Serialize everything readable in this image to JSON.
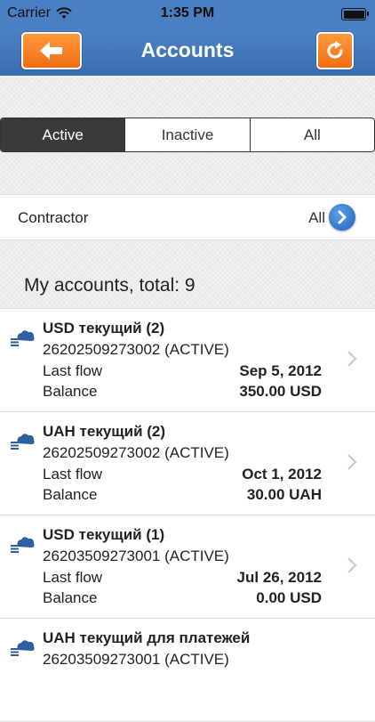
{
  "status": {
    "carrier": "Carrier",
    "time": "1:35 PM"
  },
  "nav": {
    "title": "Accounts"
  },
  "segments": [
    "Active",
    "Inactive",
    "All"
  ],
  "contractor": {
    "label": "Contractor",
    "value": "All"
  },
  "section": {
    "title": "My accounts, total: 9"
  },
  "accounts": [
    {
      "name": "USD текущий (2)",
      "number": "26202509273002 (ACTIVE)",
      "k1": "Last flow",
      "v1": "Sep 5, 2012",
      "k2": "Balance",
      "v2": "350.00 USD"
    },
    {
      "name": "UAH текущий (2)",
      "number": "26202509273002 (ACTIVE)",
      "k1": "Last flow",
      "v1": "Oct 1, 2012",
      "k2": "Balance",
      "v2": "30.00 UAH"
    },
    {
      "name": "USD текущий (1)",
      "number": "26203509273001 (ACTIVE)",
      "k1": "Last flow",
      "v1": "Jul 26, 2012",
      "k2": "Balance",
      "v2": "0.00 USD"
    },
    {
      "name": "UAH текущий для платежей",
      "number": "26203509273001 (ACTIVE)",
      "k1": "",
      "v1": "",
      "k2": "",
      "v2": ""
    }
  ],
  "colors": {
    "navbar": "#4a7fc1",
    "accent_button": "#f58220",
    "segment_active": "#3a3a3a",
    "disclosure": "#1f63b8"
  },
  "icons": {
    "back": "arrow-left-icon",
    "refresh": "refresh-icon",
    "wifi": "wifi-icon",
    "battery": "battery-icon",
    "account": "cloud-server-icon",
    "chevron": "chevron-right-icon",
    "disclosure": "disclosure-arrow-icon"
  }
}
